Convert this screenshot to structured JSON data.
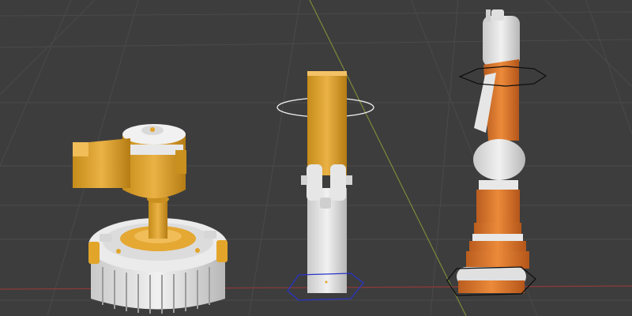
{
  "viewport": {
    "background": "#3d3d3d",
    "grid_color": "#4a4a4a",
    "axis_x_color": "#8a3a3a",
    "axis_y_color": "#7a8a3a"
  },
  "colors": {
    "yellow": "#e2a52a",
    "yellow_shade": "#b57c14",
    "orange": "#e07a2e",
    "orange_shade": "#b4561a",
    "white": "#e8e8e8",
    "white_shade": "#b9b9b9",
    "selection_outline": "#000000",
    "empty_outline_white": "#f2f2f2",
    "empty_outline_blue": "#2a34c8"
  },
  "objects": [
    {
      "id": "base-lamp",
      "icon": "cylinder-base-mesh",
      "selected": false
    },
    {
      "id": "hinge-arm",
      "icon": "hinge-block-mesh",
      "selected": true
    },
    {
      "id": "piston-column",
      "icon": "piston-mesh",
      "selected": true
    }
  ]
}
